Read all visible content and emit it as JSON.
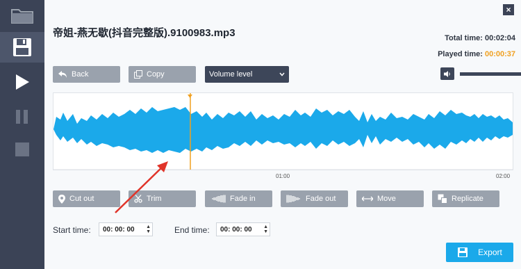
{
  "window": {
    "close_glyph": "×"
  },
  "sidebar": {
    "items": [
      {
        "icon": "folder-icon"
      },
      {
        "icon": "save-icon"
      },
      {
        "icon": "play-icon"
      },
      {
        "icon": "pause-icon"
      },
      {
        "icon": "stop-icon"
      }
    ]
  },
  "file": {
    "name": "帝姐-燕无歇(抖音完整版).9100983.mp3"
  },
  "times": {
    "total_label": "Total time:",
    "total_value": "00:02:04",
    "played_label": "Played time:",
    "played_value": "00:00:37"
  },
  "toolbar": {
    "back_label": "Back",
    "copy_label": "Copy",
    "volume_select_value": "Volume level"
  },
  "timeline": {
    "ticks": [
      "01:00",
      "02:00"
    ]
  },
  "edit_buttons": [
    {
      "label": "Cut out",
      "icon": "pin-icon"
    },
    {
      "label": "Trim",
      "icon": "scissors-icon"
    },
    {
      "label": "Fade in",
      "icon": "fade-in-icon"
    },
    {
      "label": "Fade out",
      "icon": "fade-out-icon"
    },
    {
      "label": "Move",
      "icon": "move-icon"
    },
    {
      "label": "Replicate",
      "icon": "replicate-icon"
    }
  ],
  "range": {
    "start_label": "Start time:",
    "start_value": "00: 00: 00",
    "end_label": "End time:",
    "end_value": "00: 00: 00"
  },
  "export": {
    "label": "Export"
  },
  "colors": {
    "sidebar": "#3b4356",
    "waveform": "#1ba9ea",
    "playhead": "#f0a020",
    "played_time": "#f0a020",
    "button_gray": "#9aa2ad",
    "export": "#1ba9ea",
    "annotation_arrow": "#e0342a"
  }
}
